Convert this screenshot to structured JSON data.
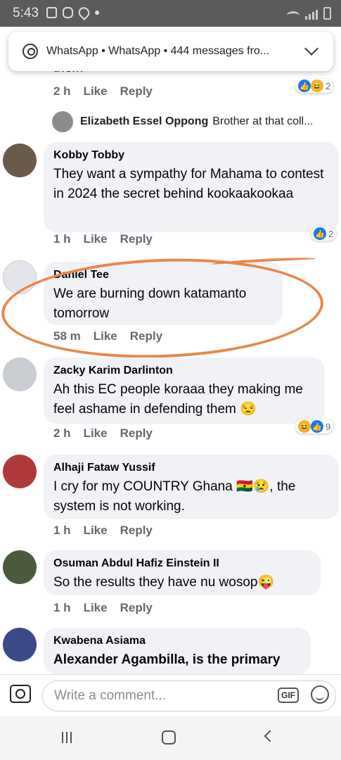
{
  "status_bar": {
    "time": "5:43"
  },
  "notification": {
    "text": "WhatsApp  •  WhatsApp  •  444 messages fro..."
  },
  "top": {
    "cut_text": "them",
    "time": "2 h",
    "like": "Like",
    "reply": "Reply",
    "react_count": "2",
    "reply_preview": {
      "name": "Elizabeth Essel Oppong",
      "text": "Brother at that coll..."
    }
  },
  "comments": [
    {
      "name": "Kobby Tobby",
      "text": "They want a sympathy for Mahama to contest in 2024 the secret behind kookaakookaa",
      "time": "1 h",
      "like": "Like",
      "reply": "Reply",
      "react_count": "2"
    },
    {
      "name": "Daniel Tee",
      "text": "We are burning down katamanto tomorrow",
      "time": "58 m",
      "like": "Like",
      "reply": "Reply"
    },
    {
      "name": "Zacky Karim Darlinton",
      "text": "Ah this EC people koraaa they making me feel ashame in defending them 😒",
      "time": "2 h",
      "like": "Like",
      "reply": "Reply",
      "react_count": "9"
    },
    {
      "name": "Alhaji Fataw Yussif",
      "text": "I cry for my COUNTRY Ghana 🇬🇭😢, the system is not working.",
      "time": "1 h",
      "like": "Like",
      "reply": "Reply"
    },
    {
      "name": "Osuman Abdul Hafiz Einstein II",
      "text": "So the results they have nu wosop😜",
      "time": "1 h",
      "like": "Like",
      "reply": "Reply"
    },
    {
      "name": "Kwabena Asiama",
      "text": "Alexander Agambilla, is the primary"
    }
  ],
  "composer": {
    "placeholder": "Write a comment...",
    "gif": "GIF"
  },
  "icons": [
    "facebook-icon",
    "instagram-icon",
    "location-icon",
    "wifi-icon",
    "whatsapp-icon",
    "chevron-down-icon",
    "camera-icon",
    "gif-icon",
    "emoji-icon",
    "recent-apps-icon",
    "home-icon",
    "back-icon"
  ],
  "colors": {
    "highlight_circle": "#e8874a",
    "like_blue": "#1877f2",
    "bubble": "#f0f2f5"
  }
}
